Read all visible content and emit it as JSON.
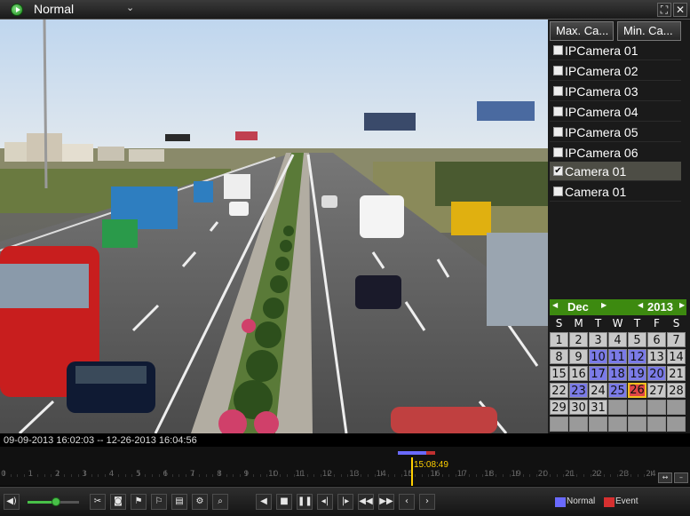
{
  "titlebar": {
    "mode": "Normal",
    "mode_arrow": "⌄",
    "icons": [
      "playback-icon",
      "fullscreen-icon",
      "close-icon"
    ]
  },
  "camera_panel": {
    "max_button": "Max. Ca...",
    "min_button": "Min. Ca...",
    "cameras": [
      {
        "name": "IPCamera 01",
        "checked": false
      },
      {
        "name": "IPCamera 02",
        "checked": false
      },
      {
        "name": "IPCamera 03",
        "checked": false
      },
      {
        "name": "IPCamera 04",
        "checked": false
      },
      {
        "name": "IPCamera 05",
        "checked": false
      },
      {
        "name": "IPCamera 06",
        "checked": false
      },
      {
        "name": "Camera 01",
        "checked": true
      },
      {
        "name": "Camera 01",
        "checked": false
      }
    ]
  },
  "calendar": {
    "month": "Dec",
    "year": "2013",
    "weekdays": [
      "S",
      "M",
      "T",
      "W",
      "T",
      "F",
      "S"
    ],
    "weeks": [
      [
        "1",
        "2",
        "3",
        "4",
        "5",
        "6",
        "7"
      ],
      [
        "8",
        "9",
        "10",
        "11",
        "12",
        "13",
        "14"
      ],
      [
        "15",
        "16",
        "17",
        "18",
        "19",
        "20",
        "21"
      ],
      [
        "22",
        "23",
        "24",
        "25",
        "26",
        "27",
        "28"
      ],
      [
        "29",
        "30",
        "31",
        "",
        "",
        "",
        ""
      ],
      [
        "",
        "",
        "",
        "",
        "",
        "",
        ""
      ]
    ],
    "recorded_days": [
      "10",
      "11",
      "12",
      "17",
      "18",
      "19",
      "20",
      "23",
      "25"
    ],
    "current_day": "26"
  },
  "timeline": {
    "range": "09-09-2013 16:02:03 -- 12-26-2013 16:04:56",
    "cursor_time": "15:08:49",
    "hours": [
      "0",
      "1",
      "2",
      "3",
      "4",
      "5",
      "6",
      "7",
      "8",
      "9",
      "10",
      "11",
      "12",
      "13",
      "14",
      "15",
      "16",
      "17",
      "18",
      "19",
      "20",
      "21",
      "22",
      "23",
      "24"
    ]
  },
  "controls": {
    "buttons": [
      "audio-icon",
      "clip-icon",
      "snapshot-icon",
      "tag-icon",
      "custom-tag-icon",
      "tag-manage-icon",
      "settings-icon",
      "search-icon",
      "prev-icon",
      "stop-icon",
      "pause-icon",
      "rewind-30s-icon",
      "forward-30s-icon",
      "slow-icon",
      "fast-icon",
      "prev-day-icon",
      "next-day-icon"
    ],
    "volume": 0.55,
    "legend_normal": "Normal",
    "legend_event": "Event",
    "colors": {
      "normal": "#6a6aff",
      "event": "#d63030",
      "accent": "#48c048"
    }
  }
}
